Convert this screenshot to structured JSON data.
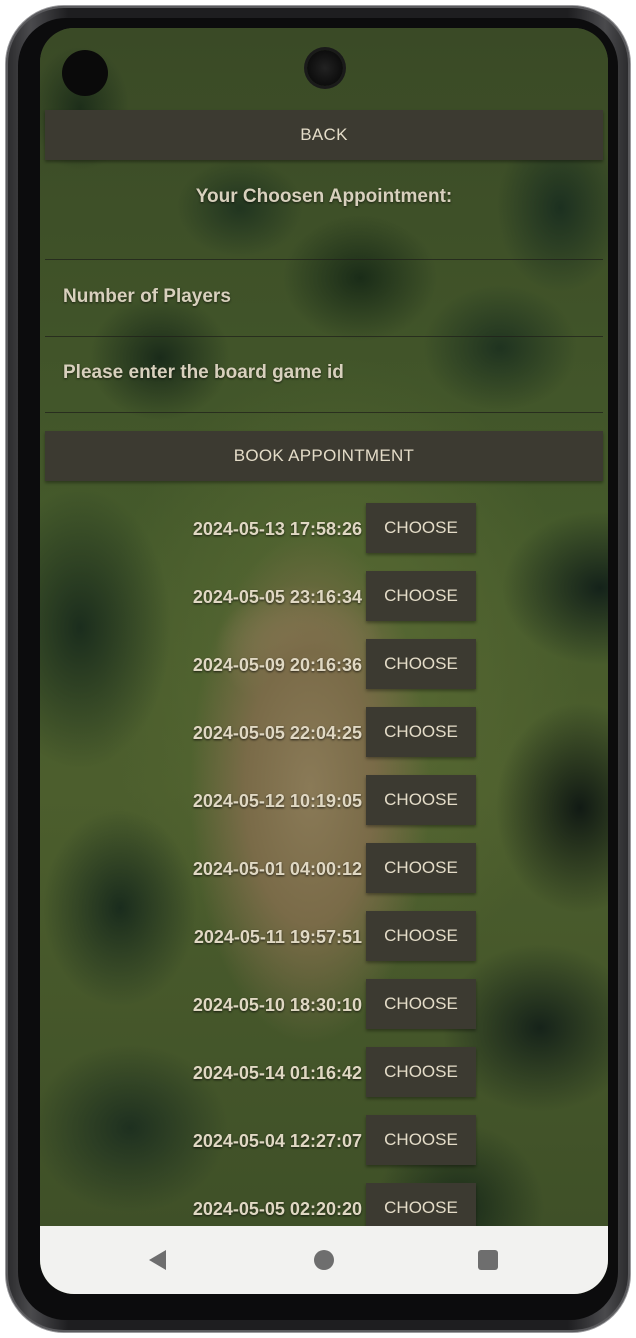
{
  "header": {
    "back_label": "BACK",
    "heading": "Your Choosen Appointment:"
  },
  "form": {
    "players_hint": "Number of Players",
    "game_id_hint": "Please enter the board game id",
    "book_label": "BOOK APPOINTMENT"
  },
  "slots": [
    {
      "time": "2024-05-13 17:58:26",
      "action": "CHOOSE"
    },
    {
      "time": "2024-05-05 23:16:34",
      "action": "CHOOSE"
    },
    {
      "time": "2024-05-09 20:16:36",
      "action": "CHOOSE"
    },
    {
      "time": "2024-05-05 22:04:25",
      "action": "CHOOSE"
    },
    {
      "time": "2024-05-12 10:19:05",
      "action": "CHOOSE"
    },
    {
      "time": "2024-05-01 04:00:12",
      "action": "CHOOSE"
    },
    {
      "time": "2024-05-11 19:57:51",
      "action": "CHOOSE"
    },
    {
      "time": "2024-05-10 18:30:10",
      "action": "CHOOSE"
    },
    {
      "time": "2024-05-14 01:16:42",
      "action": "CHOOSE"
    },
    {
      "time": "2024-05-04 12:27:07",
      "action": "CHOOSE"
    },
    {
      "time": "2024-05-05 02:20:20",
      "action": "CHOOSE"
    }
  ],
  "nav": {
    "back_icon": "triangle-back-icon",
    "home_icon": "circle-home-icon",
    "recents_icon": "square-recents-icon"
  },
  "colors": {
    "button_bg": "#3c3a31",
    "button_text": "#e4dcc8",
    "label_text": "#d8d0bd",
    "nav_bg": "#f2f2f0"
  }
}
